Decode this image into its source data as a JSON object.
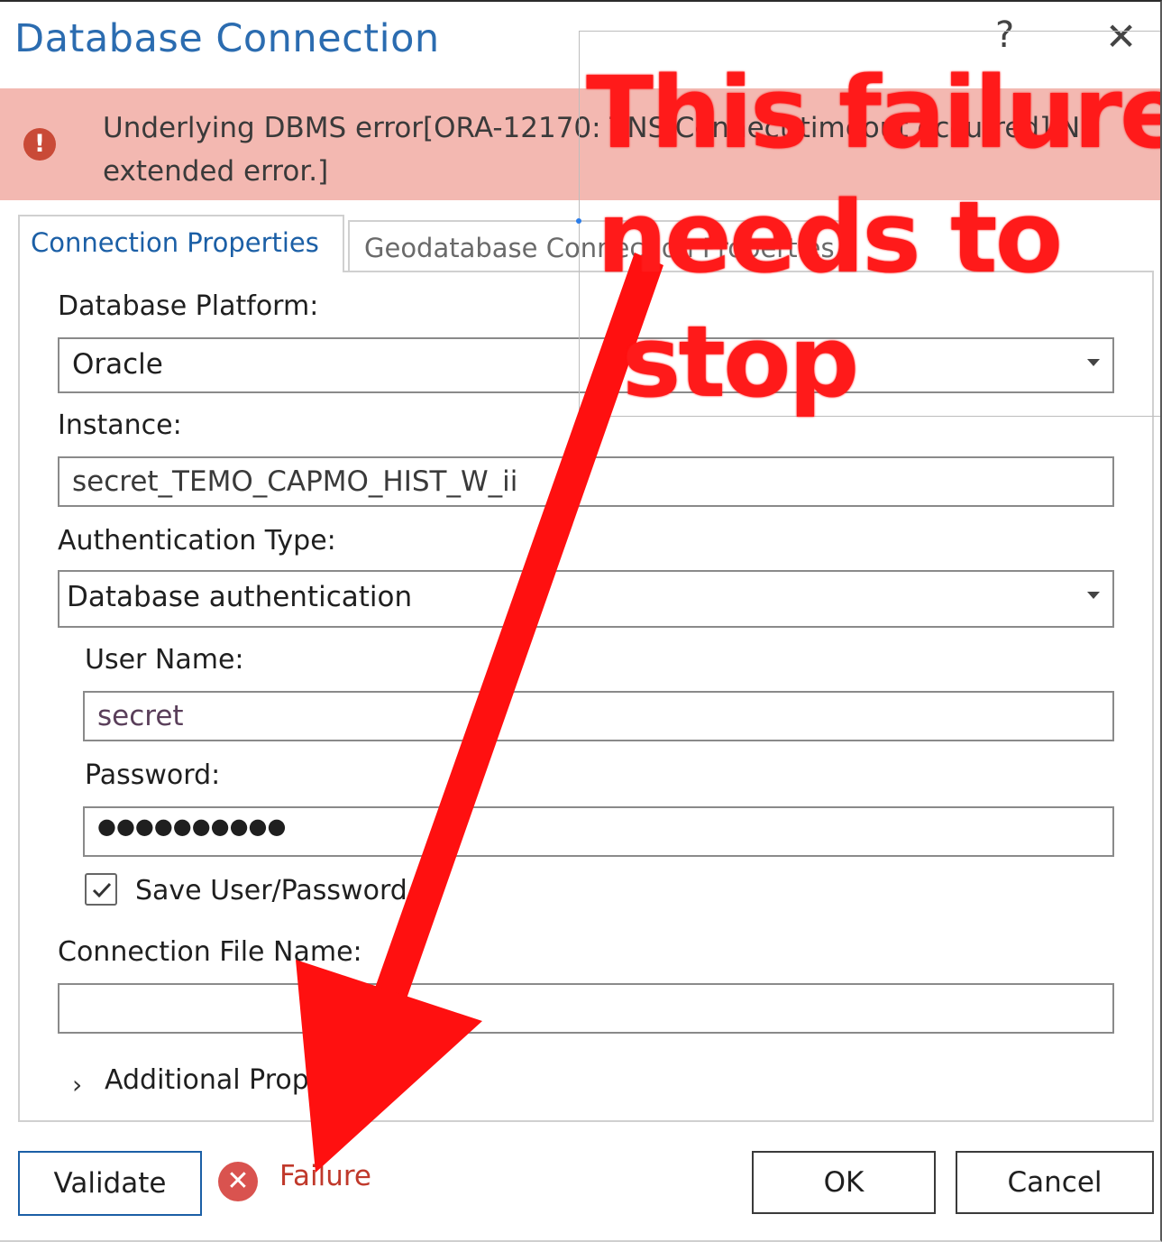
{
  "dialog": {
    "title": "Database Connection",
    "help_glyph": "?",
    "close_glyph": "✕"
  },
  "error_banner": {
    "icon_glyph": "!",
    "message_line1": "Underlying DBMS error[ORA-12170: TNS:Connect timeout occurred] No",
    "message_line2": "extended error.]"
  },
  "tabs": [
    {
      "label": "Connection Properties",
      "active": true
    },
    {
      "label": "Geodatabase Connection Properties",
      "active": false
    }
  ],
  "form": {
    "platform_label": "Database Platform:",
    "platform_value": "Oracle",
    "instance_label": "Instance:",
    "instance_value": "secret_TEMO_CAPMO_HIST_W_ii",
    "auth_label": "Authentication Type:",
    "auth_value": "Database authentication",
    "username_label": "User Name:",
    "username_value": "secret",
    "password_label": "Password:",
    "password_value": "●●●●●●●●●●",
    "save_label": "Save User/Password",
    "save_checked": true,
    "filename_label": "Connection File Name:",
    "filename_value": "",
    "additional_label": "Additional Properties"
  },
  "footer": {
    "validate_label": "Validate",
    "status_icon": "✕",
    "status_text": "Failure",
    "ok_label": "OK",
    "cancel_label": "Cancel"
  },
  "annotation": {
    "line1": "This failure",
    "line2": "needs to",
    "line3": "stop",
    "color": "#ff1a1a"
  },
  "colors": {
    "accent": "#1b5fa6",
    "error_bg": "#f3b8b1",
    "error_icon": "#c94a37",
    "failure": "#c0392b"
  }
}
